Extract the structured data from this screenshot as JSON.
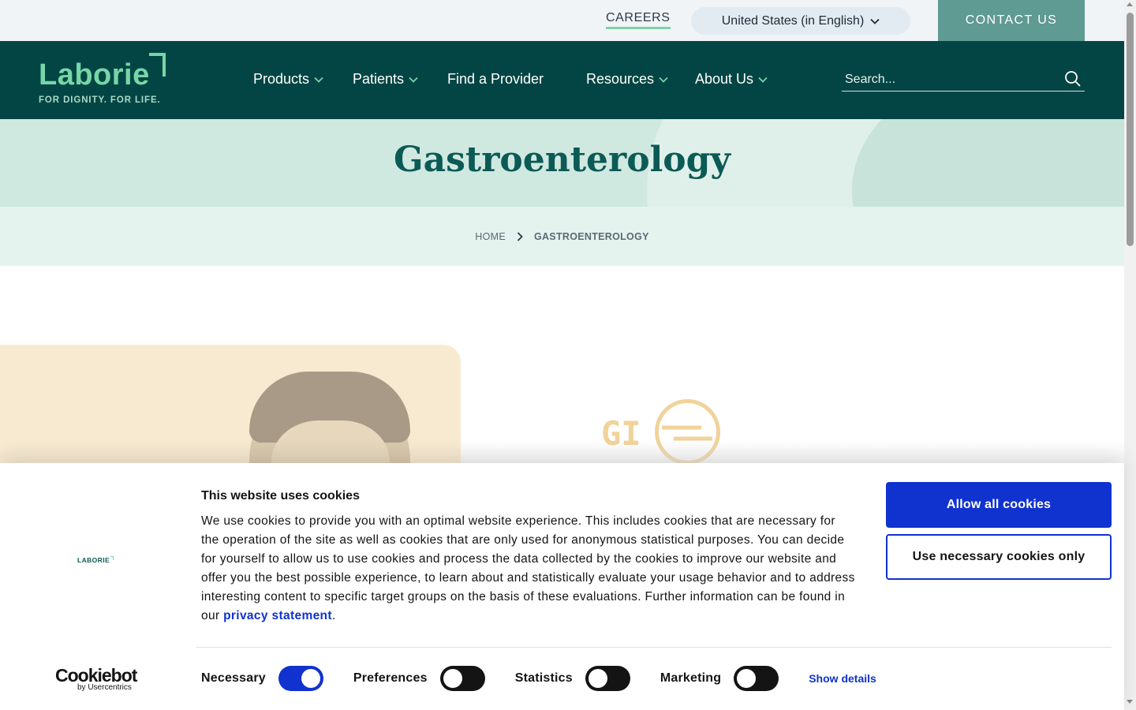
{
  "utility": {
    "careers": "CAREERS",
    "region": "United States (in English)",
    "contact": "CONTACT US"
  },
  "logo": {
    "word": "Laborie",
    "tagline": "FOR DIGNITY. FOR LIFE."
  },
  "nav": {
    "products": "Products",
    "patients": "Patients",
    "find_provider": "Find a Provider",
    "resources": "Resources",
    "about": "About Us"
  },
  "search": {
    "placeholder": "Search..."
  },
  "hero": {
    "title": "Gastroenterology"
  },
  "breadcrumb": {
    "home": "HOME",
    "current": "GASTROENTEROLOGY"
  },
  "content": {
    "gi_label": "GI"
  },
  "cookie": {
    "logo_text": "LABORIE",
    "title": "This website uses cookies",
    "text": "We use cookies to provide you with an optimal website experience. This includes cookies that are necessary for the operation of the site as well as cookies that are only used for anonymous statistical purposes. You can decide for yourself to allow us to use cookies and process the data collected by the cookies to improve our website and offer you the best possible experience, to learn about and statistically evaluate your usage behavior and to address interesting content to specific target groups on the basis of these evaluations. Further information can be found in our ",
    "privacy_link": "privacy statement",
    "text_end": ".",
    "allow_all": "Allow all cookies",
    "necessary_only": "Use necessary cookies only",
    "categories": {
      "necessary": "Necessary",
      "preferences": "Preferences",
      "statistics": "Statistics",
      "marketing": "Marketing"
    },
    "show_details": "Show details",
    "cookiebot_word": "Cookiebot",
    "cookiebot_sub": "by Usercentrics"
  },
  "colors": {
    "nav_bg": "#034544",
    "accent_green": "#77d6a6",
    "cookie_blue": "#1032cf"
  }
}
